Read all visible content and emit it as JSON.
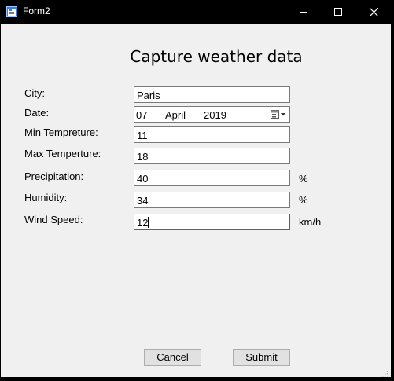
{
  "window": {
    "title": "Form2"
  },
  "form": {
    "heading": "Capture weather data",
    "fields": {
      "city": {
        "label": "City:",
        "value": "Paris"
      },
      "date": {
        "label": "Date:",
        "day": "07",
        "month": "April",
        "year": "2019"
      },
      "min_temp": {
        "label": "Min Tempreture:",
        "value": "11"
      },
      "max_temp": {
        "label": "Max Temperture:",
        "value": "18"
      },
      "precipitation": {
        "label": "Precipitation:",
        "value": "40",
        "unit": "%"
      },
      "humidity": {
        "label": "Humidity:",
        "value": "34",
        "unit": "%"
      },
      "wind_speed": {
        "label": "Wind Speed:",
        "value": "12",
        "unit": "km/h"
      }
    },
    "buttons": {
      "cancel": "Cancel",
      "submit": "Submit"
    }
  },
  "colors": {
    "titlebar": "#000000",
    "client": "#f0f0f0",
    "focus_border": "#0078d7",
    "button": "#e1e1e1"
  },
  "icons": [
    "app-form-icon",
    "minimize-icon",
    "maximize-icon",
    "close-icon",
    "calendar-dropdown-icon"
  ]
}
